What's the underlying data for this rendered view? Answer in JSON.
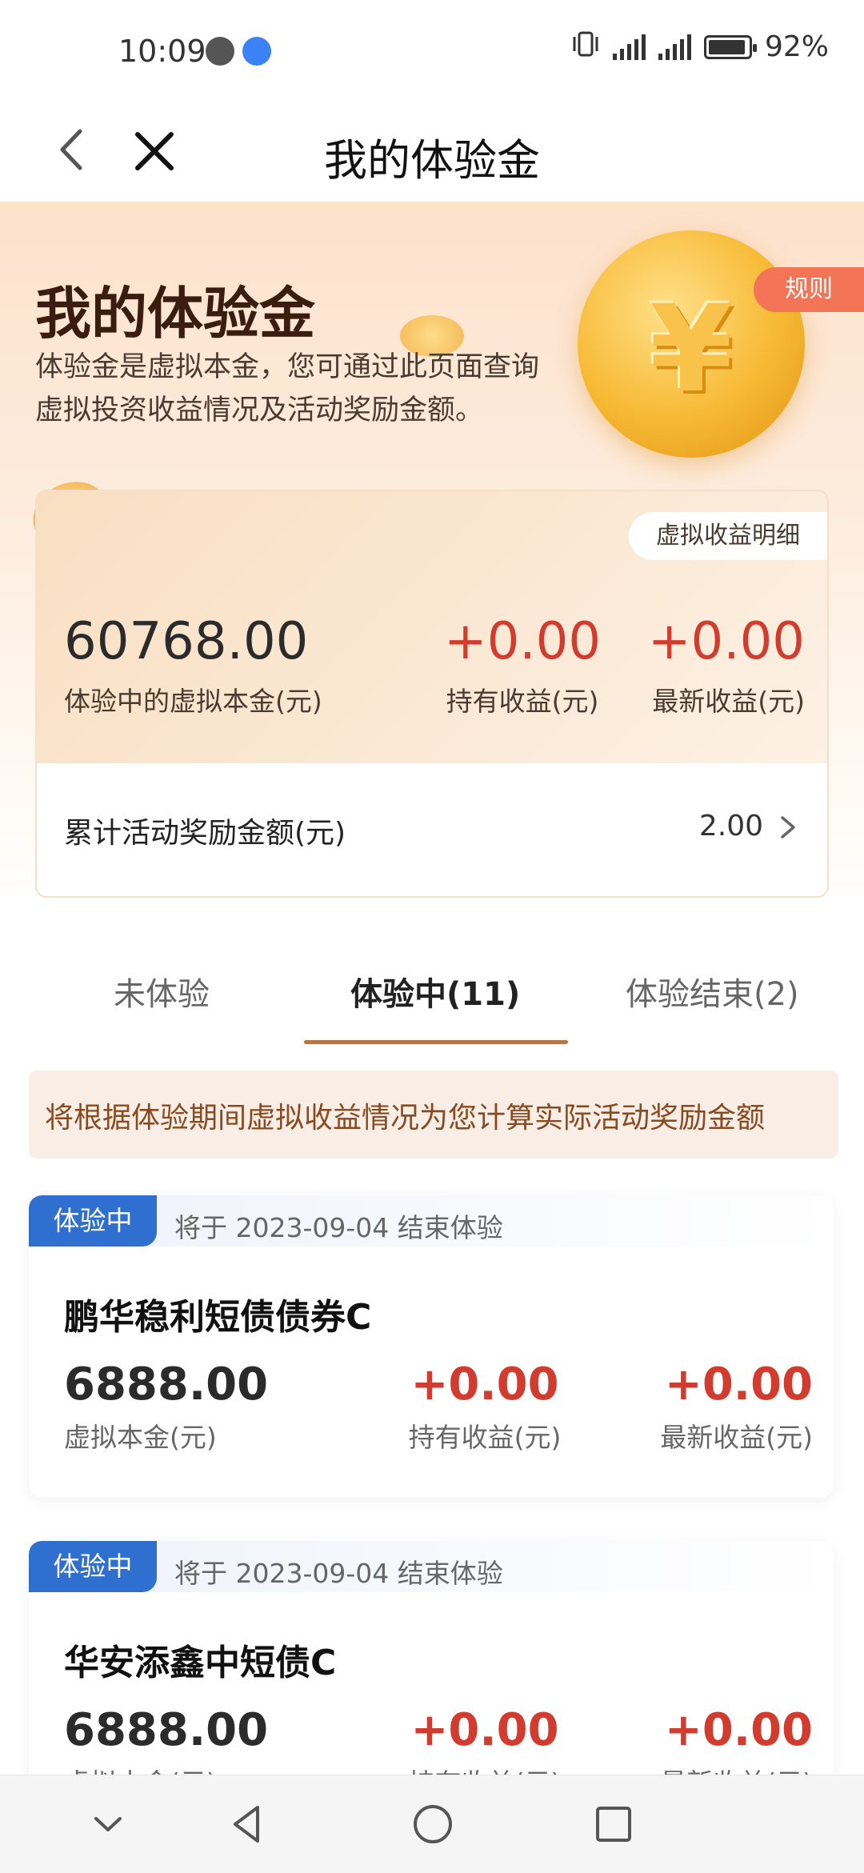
{
  "status_bar": {
    "time": "10:09",
    "signal_1": "4G",
    "signal_2": "4G",
    "battery": "92%"
  },
  "nav": {
    "title": "我的体验金"
  },
  "hero": {
    "title": "我的体验金",
    "description": "体验金是虚拟本金，您可通过此页面查询虚拟投资收益情况及活动奖励金额。",
    "rules_label": "规则",
    "coin_symbol": "¥"
  },
  "summary": {
    "detail_label": "虚拟收益明细",
    "principal_value": "60768.00",
    "principal_label": "体验中的虚拟本金(元)",
    "hold_value": "+0.00",
    "hold_label": "持有收益(元)",
    "latest_value": "+0.00",
    "latest_label": "最新收益(元)",
    "reward_label": "累计活动奖励金额(元)",
    "reward_value": "2.00"
  },
  "tabs": [
    {
      "label": "未体验"
    },
    {
      "label": "体验中(11)"
    },
    {
      "label": "体验结束(2)"
    }
  ],
  "notice": "将根据体验期间虚拟收益情况为您计算实际活动奖励金额",
  "cards": [
    {
      "status": "体验中",
      "end_text": "将于 2023-09-04 结束体验",
      "fund_name": "鹏华稳利短债债券C",
      "principal_value": "6888.00",
      "principal_label": "虚拟本金(元)",
      "hold_value": "+0.00",
      "hold_label": "持有收益(元)",
      "latest_value": "+0.00",
      "latest_label": "最新收益(元)"
    },
    {
      "status": "体验中",
      "end_text": "将于 2023-09-04 结束体验",
      "fund_name": "华安添鑫中短债C",
      "principal_value": "6888.00",
      "principal_label": "虚拟本金(元)",
      "hold_value": "+0.00",
      "hold_label": "持有收益(元)",
      "latest_value": "+0.00",
      "latest_label": "最新收益(元)"
    }
  ],
  "colors": {
    "accent_red": "#d23c2e",
    "badge_blue": "#2f6fcf",
    "tab_underline": "#b87444"
  }
}
